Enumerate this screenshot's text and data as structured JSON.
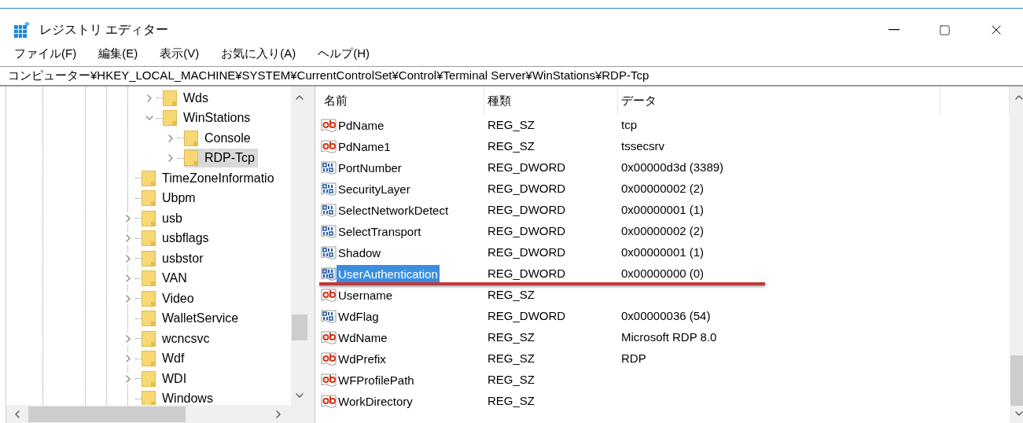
{
  "window": {
    "title": "レジストリ エディター"
  },
  "menu": [
    "ファイル(F)",
    "編集(E)",
    "表示(V)",
    "お気に入り(A)",
    "ヘルプ(H)"
  ],
  "address": "コンピューター¥HKEY_LOCAL_MACHINE¥SYSTEM¥CurrentControlSet¥Control¥Terminal Server¥WinStations¥RDP-Tcp",
  "tree": {
    "continued_children": [
      {
        "label": "Wds",
        "kind": "branch",
        "expanded": false,
        "selected": false
      },
      {
        "label": "WinStations",
        "kind": "branch",
        "expanded": true,
        "selected": false,
        "children": [
          {
            "label": "Console",
            "kind": "branch",
            "expanded": false,
            "selected": false
          },
          {
            "label": "RDP-Tcp",
            "kind": "branch",
            "expanded": false,
            "selected": true
          }
        ]
      }
    ],
    "items": [
      {
        "label": "TimeZoneInformatio",
        "kind": "leaf",
        "selected": false
      },
      {
        "label": "Ubpm",
        "kind": "leaf",
        "selected": false
      },
      {
        "label": "usb",
        "kind": "branch",
        "expanded": false,
        "selected": false
      },
      {
        "label": "usbflags",
        "kind": "branch",
        "expanded": false,
        "selected": false
      },
      {
        "label": "usbstor",
        "kind": "branch",
        "expanded": false,
        "selected": false
      },
      {
        "label": "VAN",
        "kind": "branch",
        "expanded": false,
        "selected": false
      },
      {
        "label": "Video",
        "kind": "branch",
        "expanded": false,
        "selected": false
      },
      {
        "label": "WalletService",
        "kind": "leaf",
        "selected": false
      },
      {
        "label": "wcncsvc",
        "kind": "branch",
        "expanded": false,
        "selected": false
      },
      {
        "label": "Wdf",
        "kind": "branch",
        "expanded": false,
        "selected": false
      },
      {
        "label": "WDI",
        "kind": "branch",
        "expanded": false,
        "selected": false
      },
      {
        "label": "Windows",
        "kind": "leaf",
        "selected": false
      }
    ]
  },
  "table": {
    "columns": [
      "名前",
      "種類",
      "データ"
    ],
    "rows": [
      {
        "name": "PdName",
        "kind": "string",
        "type": "REG_SZ",
        "data": "tcp",
        "selected": false,
        "underlined": false
      },
      {
        "name": "PdName1",
        "kind": "string",
        "type": "REG_SZ",
        "data": "tssecsrv",
        "selected": false,
        "underlined": false
      },
      {
        "name": "PortNumber",
        "kind": "binary",
        "type": "REG_DWORD",
        "data": "0x00000d3d (3389)",
        "selected": false,
        "underlined": false
      },
      {
        "name": "SecurityLayer",
        "kind": "binary",
        "type": "REG_DWORD",
        "data": "0x00000002 (2)",
        "selected": false,
        "underlined": false
      },
      {
        "name": "SelectNetworkDetect",
        "kind": "binary",
        "type": "REG_DWORD",
        "data": "0x00000001 (1)",
        "selected": false,
        "underlined": false
      },
      {
        "name": "SelectTransport",
        "kind": "binary",
        "type": "REG_DWORD",
        "data": "0x00000002 (2)",
        "selected": false,
        "underlined": false
      },
      {
        "name": "Shadow",
        "kind": "binary",
        "type": "REG_DWORD",
        "data": "0x00000001 (1)",
        "selected": false,
        "underlined": false
      },
      {
        "name": "UserAuthentication",
        "kind": "binary",
        "type": "REG_DWORD",
        "data": "0x00000000 (0)",
        "selected": true,
        "underlined": true
      },
      {
        "name": "Username",
        "kind": "string",
        "type": "REG_SZ",
        "selected": false,
        "underlined": false
      },
      {
        "name": "WdFlag",
        "kind": "binary",
        "type": "REG_DWORD",
        "data": "0x00000036 (54)",
        "selected": false,
        "underlined": false
      },
      {
        "name": "WdName",
        "kind": "string",
        "type": "REG_SZ",
        "data": "Microsoft RDP 8.0",
        "selected": false,
        "underlined": false
      },
      {
        "name": "WdPrefix",
        "kind": "string",
        "type": "REG_SZ",
        "data": "RDP",
        "selected": false,
        "underlined": false
      },
      {
        "name": "WFProfilePath",
        "kind": "string",
        "type": "REG_SZ",
        "selected": false,
        "underlined": false
      },
      {
        "name": "WorkDirectory",
        "kind": "string",
        "type": "REG_SZ",
        "selected": false,
        "underlined": false
      }
    ]
  }
}
